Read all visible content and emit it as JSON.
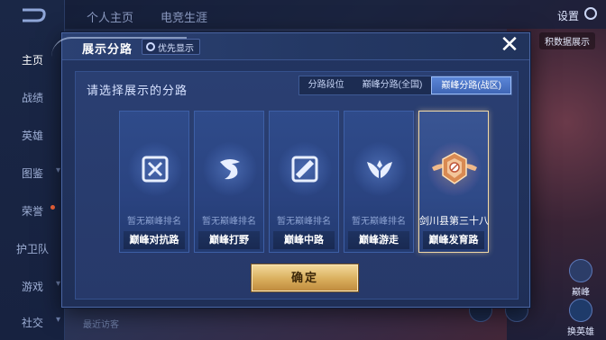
{
  "background": {
    "sidebar": {
      "items": [
        {
          "label": "主页",
          "active": true
        },
        {
          "label": "战绩"
        },
        {
          "label": "英雄"
        },
        {
          "label": "图鉴"
        },
        {
          "label": "荣誉"
        },
        {
          "label": "护卫队"
        },
        {
          "label": "游戏"
        },
        {
          "label": "社交"
        }
      ]
    },
    "top_tabs": [
      "个人主页",
      "电竞生涯"
    ],
    "settings_label": "设置",
    "chip_label": "积数据展示",
    "peak_label": "巅峰",
    "hero_label": "换英雄",
    "visitors_label": "最近访客"
  },
  "modal": {
    "title": "展示分路",
    "priority_label": "优先显示",
    "close_icon": "close-icon",
    "prompt": "请选择展示的分路",
    "segments": [
      {
        "label": "分路段位",
        "active": false
      },
      {
        "label": "巅峰分路(全国)",
        "active": false
      },
      {
        "label": "巅峰分路(战区)",
        "active": true
      }
    ],
    "cards": [
      {
        "icon": "clash-lane-icon",
        "rank": "暂无巅峰排名",
        "label": "巅峰对抗路",
        "selected": false
      },
      {
        "icon": "jungle-icon",
        "rank": "暂无巅峰排名",
        "label": "巅峰打野",
        "selected": false
      },
      {
        "icon": "mid-lane-icon",
        "rank": "暂无巅峰排名",
        "label": "巅峰中路",
        "selected": false
      },
      {
        "icon": "roam-icon",
        "rank": "暂无巅峰排名",
        "label": "巅峰游走",
        "selected": false
      },
      {
        "icon": "farm-lane-badge-icon",
        "rank": "剑川县第三十八",
        "label": "巅峰发育路",
        "selected": true
      }
    ],
    "confirm_label": "确定"
  },
  "colors": {
    "modal_bg": "#233561",
    "selected_border": "#f1d9a7",
    "confirm_gold": "#d9ae5c",
    "active_segment": "#4a74c6"
  }
}
